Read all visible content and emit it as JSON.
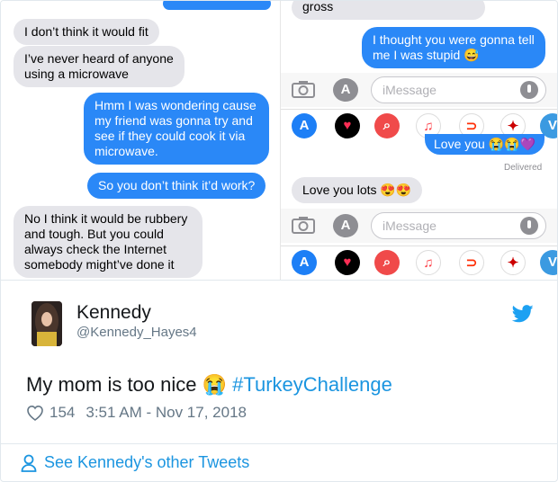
{
  "left_convo": {
    "messages": [
      {
        "side": "in",
        "text": "I don’t think it would fit"
      },
      {
        "side": "in",
        "text": "I’ve never heard of anyone\nusing a microwave"
      },
      {
        "side": "out",
        "text": "Hmm I was wondering cause\nmy friend was gonna try and\nsee if they could cook it via\nmicrowave."
      },
      {
        "side": "out",
        "text": "So you don’t think it’d work?"
      },
      {
        "side": "in",
        "text": "No I think it would be rubbery\nand tough. But you could\nalways check the Internet\nsomebody might’ve done it"
      }
    ]
  },
  "right_convo": {
    "top_partial": "gross",
    "out_msg": "I thought you were gonna tell\nme I was stupid 😅",
    "input_placeholder": "iMessage",
    "love_out": "Love you 😭😭💜",
    "delivered": "Delivered",
    "love_in": "Love you lots 😍😍",
    "input_placeholder_2": "iMessage"
  },
  "tweet": {
    "name": "Kennedy",
    "handle": "@Kennedy_Hayes4",
    "text": "My mom is too nice 😭",
    "hashtag": "#TurkeyChallenge",
    "likes": "154",
    "timestamp": "3:51 AM - Nov 17, 2018",
    "other_link": "See Kennedy's other Tweets"
  },
  "colors": {
    "imessage_blue": "#2a88f7",
    "incoming_gray": "#e5e5ea",
    "twitter_blue": "#1b95e0"
  },
  "icons": [
    "camera-icon",
    "app-store-icon",
    "mic-icon",
    "twitter-bird-icon",
    "heart-icon",
    "person-icon"
  ]
}
